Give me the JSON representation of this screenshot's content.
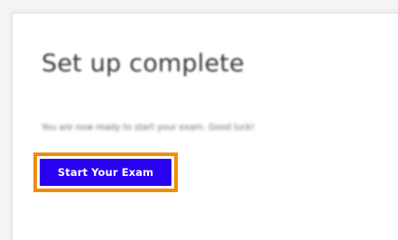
{
  "setup": {
    "title": "Set up complete",
    "message": "You are now ready to start your exam. Good luck!",
    "start_button_label": "Start Your Exam"
  },
  "colors": {
    "button_background": "#2a00f0",
    "button_text": "#ffffff",
    "focus_ring": "#f08c10",
    "title_text": "#3a3a3a",
    "message_text": "#6c6c6c"
  }
}
